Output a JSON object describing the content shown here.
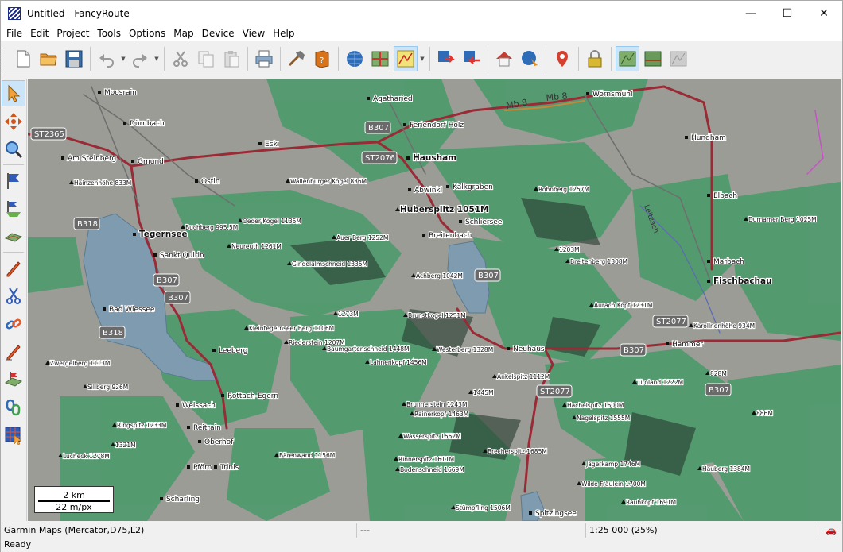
{
  "window": {
    "title": "Untitled - FancyRoute",
    "minimize": "—",
    "maximize": "☐",
    "close": "✕"
  },
  "menu": [
    "File",
    "Edit",
    "Project",
    "Tools",
    "Options",
    "Map",
    "Device",
    "View",
    "Help"
  ],
  "colors": {
    "terrain_green": "#4f9a6c",
    "terrain_gray": "#9a9c95",
    "lake": "#7f9bb0",
    "road": "#a0303a",
    "road_gray": "#7a7a7a"
  },
  "toolbar_icons": [
    "new-file-icon",
    "open-folder-icon",
    "save-icon",
    "undo-icon",
    "redo-icon",
    "cut-icon",
    "copy-icon",
    "paste-icon",
    "print-icon",
    "tools-icon",
    "help-book-icon",
    "globe-icon",
    "map-tiles-icon",
    "map-style-icon",
    "route-send-icon",
    "route-receive-icon",
    "home-icon",
    "locate-icon",
    "poi-icon",
    "lock-icon",
    "map-layer-icon",
    "map-area-icon",
    "map-area-disabled-icon"
  ],
  "side_icons": [
    "pointer-icon",
    "pan-icon",
    "zoom-icon",
    "waypoint-flag-icon",
    "route-icon",
    "track-icon",
    "pencil-icon",
    "scissors-icon",
    "join-icon",
    "draw-icon",
    "track-edit-icon",
    "link-icon",
    "select-area-icon"
  ],
  "map": {
    "scale_distance": "2 km",
    "scale_resolution": "22 m/px",
    "places": [
      {
        "name": "Moosrain"
      },
      {
        "name": "Agatharied"
      },
      {
        "name": "Wörnsmühl"
      },
      {
        "name": "Dürnbach"
      },
      {
        "name": "Feriendorf Holz"
      },
      {
        "name": "Hundham"
      },
      {
        "name": "Eck"
      },
      {
        "name": "Hausham"
      },
      {
        "name": "Am Steinberg"
      },
      {
        "name": "Gmund"
      },
      {
        "name": "Hainzenhöhe 833M"
      },
      {
        "name": "Ostin"
      },
      {
        "name": "Wallenburger Kogel 836M"
      },
      {
        "name": "Abwinkl"
      },
      {
        "name": "Kalkgraben"
      },
      {
        "name": "Rohnberg 1257M"
      },
      {
        "name": "Elbach"
      },
      {
        "name": "Hubersplitz 1051M"
      },
      {
        "name": "Schliersee"
      },
      {
        "name": "Durnamer Berg 1025M"
      },
      {
        "name": "Oeder Kogel 1135M"
      },
      {
        "name": "Buchberg 995.5M"
      },
      {
        "name": "Tegernsee"
      },
      {
        "name": "Breitenbach"
      },
      {
        "name": "Auer Berg 1252M"
      },
      {
        "name": "Neureuth 1261M"
      },
      {
        "name": "Sankt Quirin"
      },
      {
        "name": "Gindelalmschneid 1335M"
      },
      {
        "name": "Breitenberg 1308M"
      },
      {
        "name": "Marbach"
      },
      {
        "name": "Fischbachau"
      },
      {
        "name": "Achberg 1042M"
      },
      {
        "name": "Bad Wiessee"
      },
      {
        "name": "Aurach Kopf 1231M"
      },
      {
        "name": "1273M"
      },
      {
        "name": "Brunstkogel 1251M"
      },
      {
        "name": "Karollnenhöhe 934M"
      },
      {
        "name": "Kleintegernseer Berg 1106M"
      },
      {
        "name": "Riederstein 1207M"
      },
      {
        "name": "Hammer"
      },
      {
        "name": "Leeberg"
      },
      {
        "name": "Baumgartenschneid 1448M"
      },
      {
        "name": "Westerberg 1328M"
      },
      {
        "name": "Neuhaus"
      },
      {
        "name": "Zwergelberg 1113M"
      },
      {
        "name": "Lahnenkopf 1456M"
      },
      {
        "name": "Ankelspitz 1112M"
      },
      {
        "name": "Tiroland 1222M"
      },
      {
        "name": "828M"
      },
      {
        "name": "Sillberg 926M"
      },
      {
        "name": "Rottach-Egern"
      },
      {
        "name": "Hachelspitz 1500M"
      },
      {
        "name": "Brunnerstein 1243M"
      },
      {
        "name": "Weissach"
      },
      {
        "name": "Rainerkopf 1463M"
      },
      {
        "name": "Nagelspitz 1555M"
      },
      {
        "name": "886M"
      },
      {
        "name": "Ringspitz 1233M"
      },
      {
        "name": "Reitrain"
      },
      {
        "name": "Wasserspitz 1552M"
      },
      {
        "name": "Oberhof"
      },
      {
        "name": "1321M"
      },
      {
        "name": "Brecherspitz 1685M"
      },
      {
        "name": "Lucheck 1278M"
      },
      {
        "name": "Bärenwand 1156M"
      },
      {
        "name": "Rinnerspitz 1611M"
      },
      {
        "name": "Jägerkamp 1746M"
      },
      {
        "name": "Hauberg 1384M"
      },
      {
        "name": "Pförn"
      },
      {
        "name": "Trinis"
      },
      {
        "name": "Bodenschneid 1669M"
      },
      {
        "name": "Wilde Fräulein 1700M"
      },
      {
        "name": "Rauhkopf 1691M"
      },
      {
        "name": "Scharling"
      },
      {
        "name": "Stümpfling 1506M"
      },
      {
        "name": "Spitzingsee"
      },
      {
        "name": "1203M"
      },
      {
        "name": "1445M"
      }
    ],
    "road_labels": [
      "ST2365",
      "B307",
      "ST2076",
      "B318",
      "B307",
      "B307",
      "B318",
      "B307",
      "ST2077",
      "B307",
      "ST2077",
      "B307"
    ],
    "road_other": [
      "Mb 8",
      "Mb 8",
      "Leitzach"
    ]
  },
  "status": {
    "map_name": "Garmin Maps (Mercator,D75,L2)",
    "coords": "---",
    "scale": "1:25 000 (25%)",
    "ready": "Ready"
  }
}
